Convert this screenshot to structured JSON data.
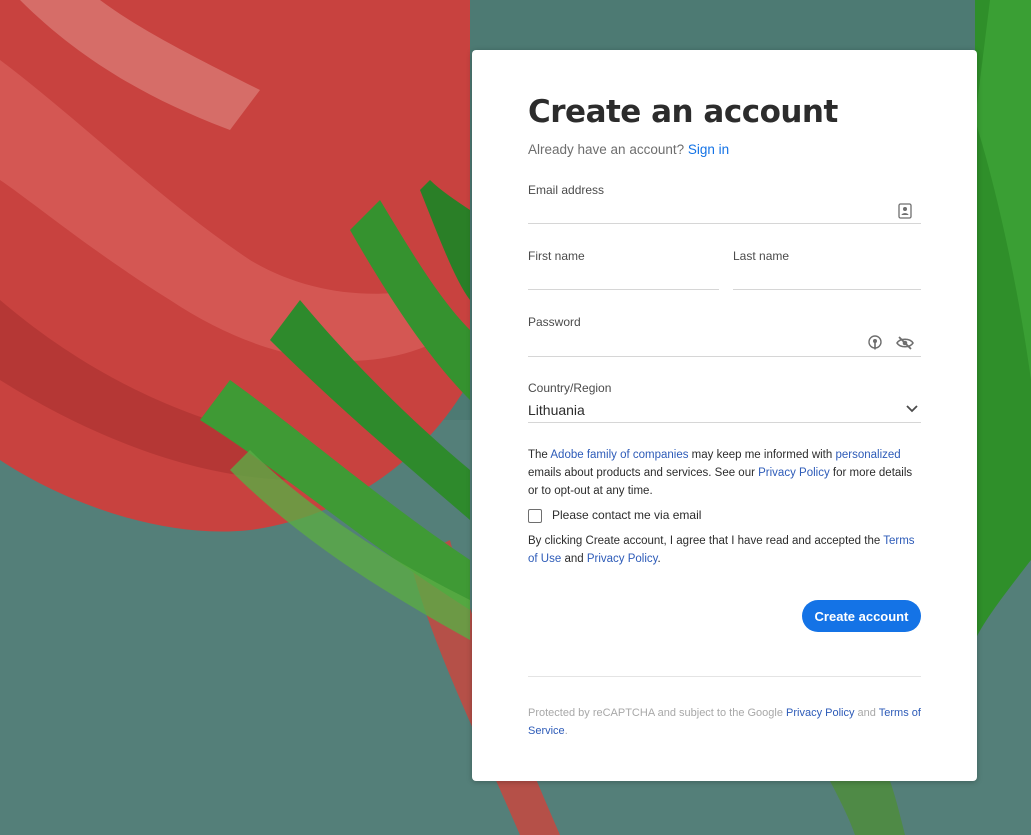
{
  "form": {
    "title": "Create an account",
    "subtitle_text": "Already have an account?",
    "signin_link": "Sign in",
    "email": {
      "label": "Email address",
      "value": ""
    },
    "first_name": {
      "label": "First name",
      "value": ""
    },
    "last_name": {
      "label": "Last name",
      "value": ""
    },
    "password": {
      "label": "Password",
      "value": ""
    },
    "country": {
      "label": "Country/Region",
      "value": "Lithuania"
    },
    "consent": {
      "part1": "The ",
      "link1": "Adobe family of companies",
      "part2": " may keep me informed with ",
      "link2": "personalized",
      "part3": " emails about products and services. See our ",
      "link3": "Privacy Policy",
      "part4": " for more details or to opt-out at any time."
    },
    "checkbox_label": "Please contact me via email",
    "terms": {
      "part1": "By clicking Create account, I agree that I have read and accepted the ",
      "link1": "Terms of Use",
      "part2": " and ",
      "link2": "Privacy Policy",
      "part3": "."
    },
    "submit_label": "Create account",
    "recaptcha": {
      "part1": "Protected by reCAPTCHA and subject to the Google ",
      "link1": "Privacy Policy",
      "part2": " and ",
      "link2": "Terms of Service",
      "part3": "."
    }
  },
  "icons": {
    "email": "contact-card-icon",
    "password_generate": "key-suggest-icon",
    "password_visibility": "eye-slash-icon",
    "country_dropdown": "chevron-down-icon"
  },
  "colors": {
    "accent": "#1473e6",
    "link": "#2d5bb8",
    "background": "#4e7a72"
  }
}
